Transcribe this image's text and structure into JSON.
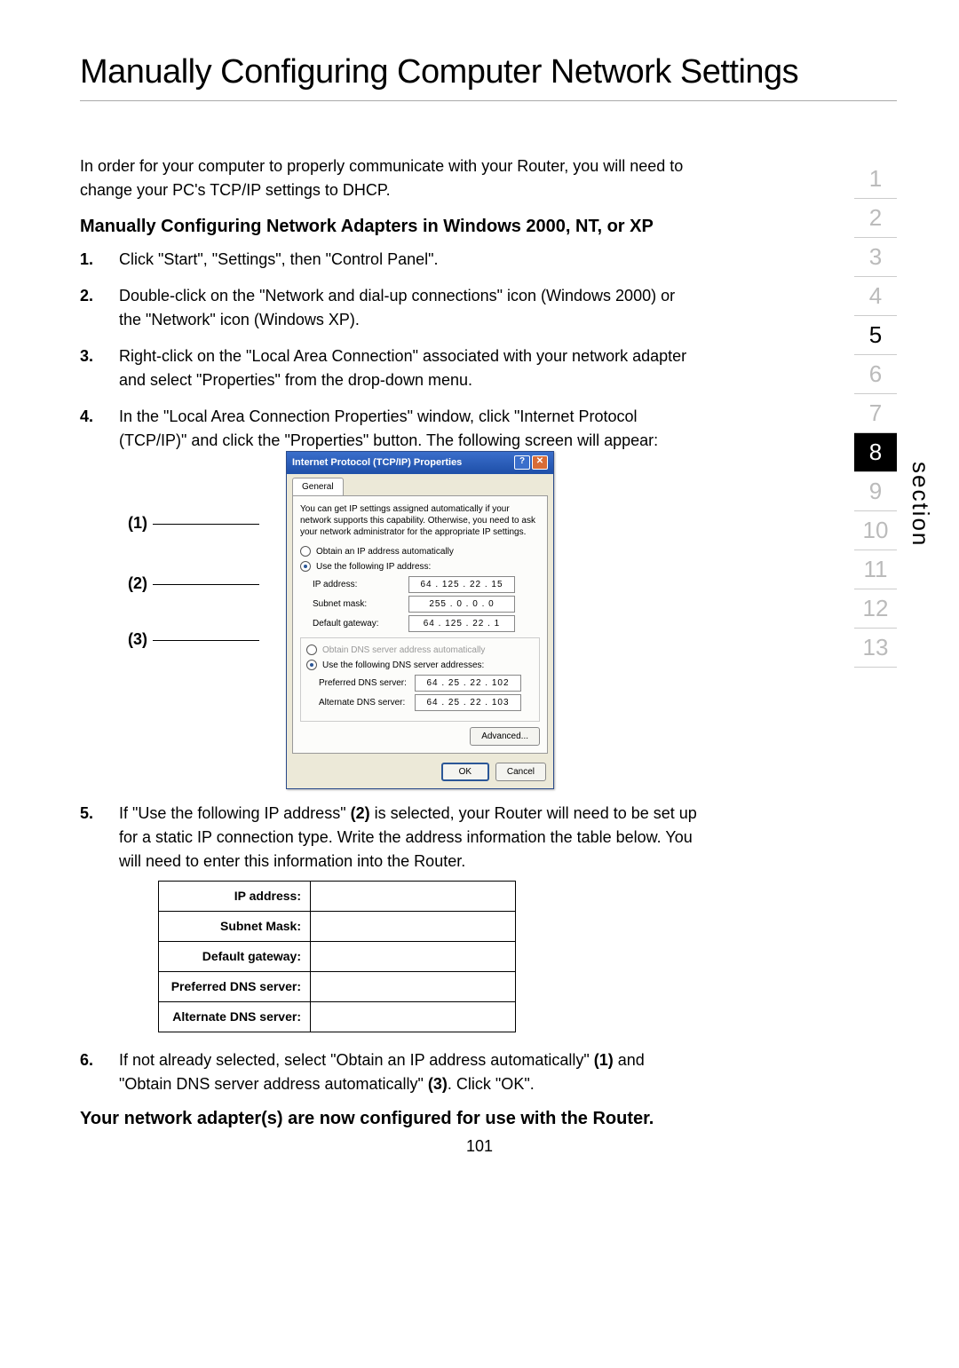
{
  "title": "Manually Configuring Computer Network Settings",
  "lead": "In order for your computer to properly communicate with your Router, you will need to change your PC's TCP/IP settings to DHCP.",
  "subhead": "Manually Configuring Network Adapters in Windows 2000, NT, or XP",
  "steps": {
    "s1": {
      "num": "1.",
      "text": "Click \"Start\", \"Settings\", then \"Control Panel\"."
    },
    "s2": {
      "num": "2.",
      "text": "Double-click on the \"Network and dial-up connections\" icon (Windows 2000) or the \"Network\" icon (Windows XP)."
    },
    "s3": {
      "num": "3.",
      "text": "Right-click on the \"Local Area Connection\" associated with your network adapter and select \"Properties\" from the drop-down menu."
    },
    "s4": {
      "num": "4.",
      "text": "In the \"Local Area Connection Properties\" window, click \"Internet Protocol (TCP/IP)\" and click the \"Properties\" button. The following screen will appear:"
    },
    "s5": {
      "num": "5.",
      "pre": "If \"Use the following IP address\" ",
      "bold1": "(2)",
      "post": " is selected, your Router will need to be set up for a static IP connection type. Write the address information the table below. You will need to enter this information into the Router."
    },
    "s6": {
      "num": "6.",
      "pre": "If not already selected, select \"Obtain an IP address automatically\" ",
      "bold1": "(1)",
      "mid": " and \"Obtain DNS server address automatically\" ",
      "bold2": "(3)",
      "post": ". Click \"OK\"."
    }
  },
  "callouts": {
    "c1": "(1)",
    "c2": "(2)",
    "c3": "(3)"
  },
  "dialog": {
    "title": "Internet Protocol (TCP/IP) Properties",
    "help_glyph": "?",
    "close_glyph": "✕",
    "tab": "General",
    "desc": "You can get IP settings assigned automatically if your network supports this capability. Otherwise, you need to ask your network administrator for the appropriate IP settings.",
    "radio_auto_ip": "Obtain an IP address automatically",
    "radio_static_ip": "Use the following IP address:",
    "ip_label": "IP address:",
    "ip_value": "64 . 125 . 22 . 15",
    "subnet_label": "Subnet mask:",
    "subnet_value": "255 . 0 . 0 . 0",
    "gw_label": "Default gateway:",
    "gw_value": "64 . 125 . 22 . 1",
    "radio_auto_dns": "Obtain DNS server address automatically",
    "radio_static_dns": "Use the following DNS server addresses:",
    "pref_dns_label": "Preferred DNS server:",
    "pref_dns_value": "64 . 25 . 22 . 102",
    "alt_dns_label": "Alternate DNS server:",
    "alt_dns_value": "64 . 25 . 22 . 103",
    "advanced": "Advanced...",
    "ok": "OK",
    "cancel": "Cancel"
  },
  "note_table": {
    "rows": [
      "IP address:",
      "Subnet Mask:",
      "Default gateway:",
      "Preferred DNS server:",
      "Alternate DNS server:"
    ]
  },
  "closing": "Your network adapter(s) are now configured for use with the Router.",
  "page_number": "101",
  "sidenav": {
    "items": [
      "1",
      "2",
      "3",
      "4",
      "5",
      "6",
      "7",
      "8",
      "9",
      "10",
      "11",
      "12",
      "13"
    ],
    "active": "8",
    "dark": "5",
    "label": "section"
  }
}
